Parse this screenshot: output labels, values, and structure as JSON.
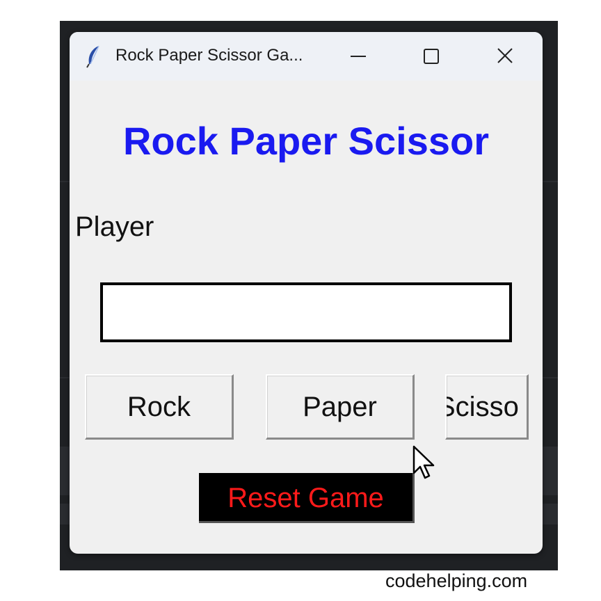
{
  "window": {
    "title": "Rock Paper Scissor Ga...",
    "app_icon": "feather-icon",
    "controls": [
      "minimize-icon",
      "maximize-icon",
      "close-icon"
    ]
  },
  "app": {
    "heading": "Rock Paper Scissor",
    "player_label": "Player",
    "player_entry_value": "",
    "buttons": {
      "rock": "Rock",
      "paper": "Paper",
      "scissor": "Scisso"
    },
    "reset_label": "Reset Game"
  },
  "colors": {
    "heading": "#1a1af0",
    "reset_bg": "#000000",
    "reset_text": "#ff1a1a"
  },
  "footer": {
    "watermark": "codehelping.com"
  }
}
